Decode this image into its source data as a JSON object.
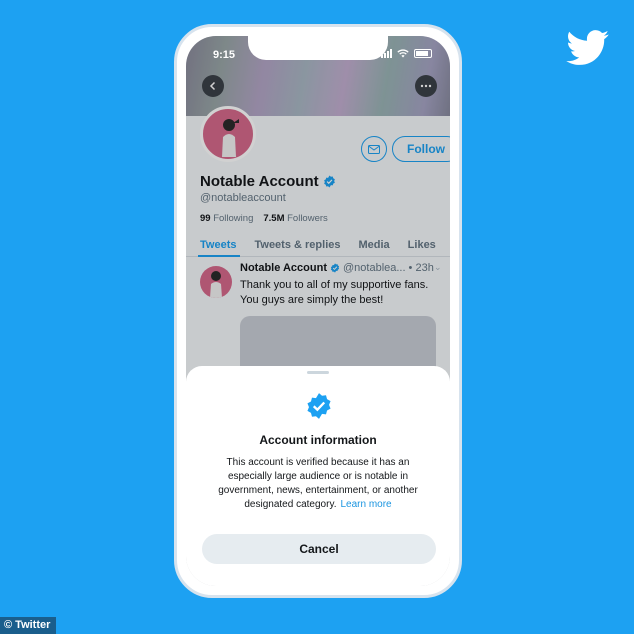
{
  "brand": {
    "color": "#1da1f2",
    "logo_icon": "twitter-bird-icon"
  },
  "credit": "© Twitter",
  "status_bar": {
    "time": "9:15"
  },
  "profile": {
    "display_name": "Notable Account",
    "handle": "@notableaccount",
    "following_count": "99",
    "following_label": "Following",
    "followers_count": "7.5M",
    "followers_label": "Followers",
    "follow_label": "Follow"
  },
  "tabs": [
    {
      "label": "Tweets",
      "active": true
    },
    {
      "label": "Tweets & replies",
      "active": false
    },
    {
      "label": "Media",
      "active": false
    },
    {
      "label": "Likes",
      "active": false
    }
  ],
  "tweet": {
    "name": "Notable Account",
    "handle": "@notablea...",
    "time": "• 23h",
    "text": "Thank you to all of my supportive fans. You guys are simply the best!"
  },
  "sheet": {
    "title": "Account information",
    "body": "This account is verified because it has an especially large audience or is notable in government, news, entertainment, or another designated category.",
    "learn_more": "Learn more",
    "cancel_label": "Cancel"
  }
}
